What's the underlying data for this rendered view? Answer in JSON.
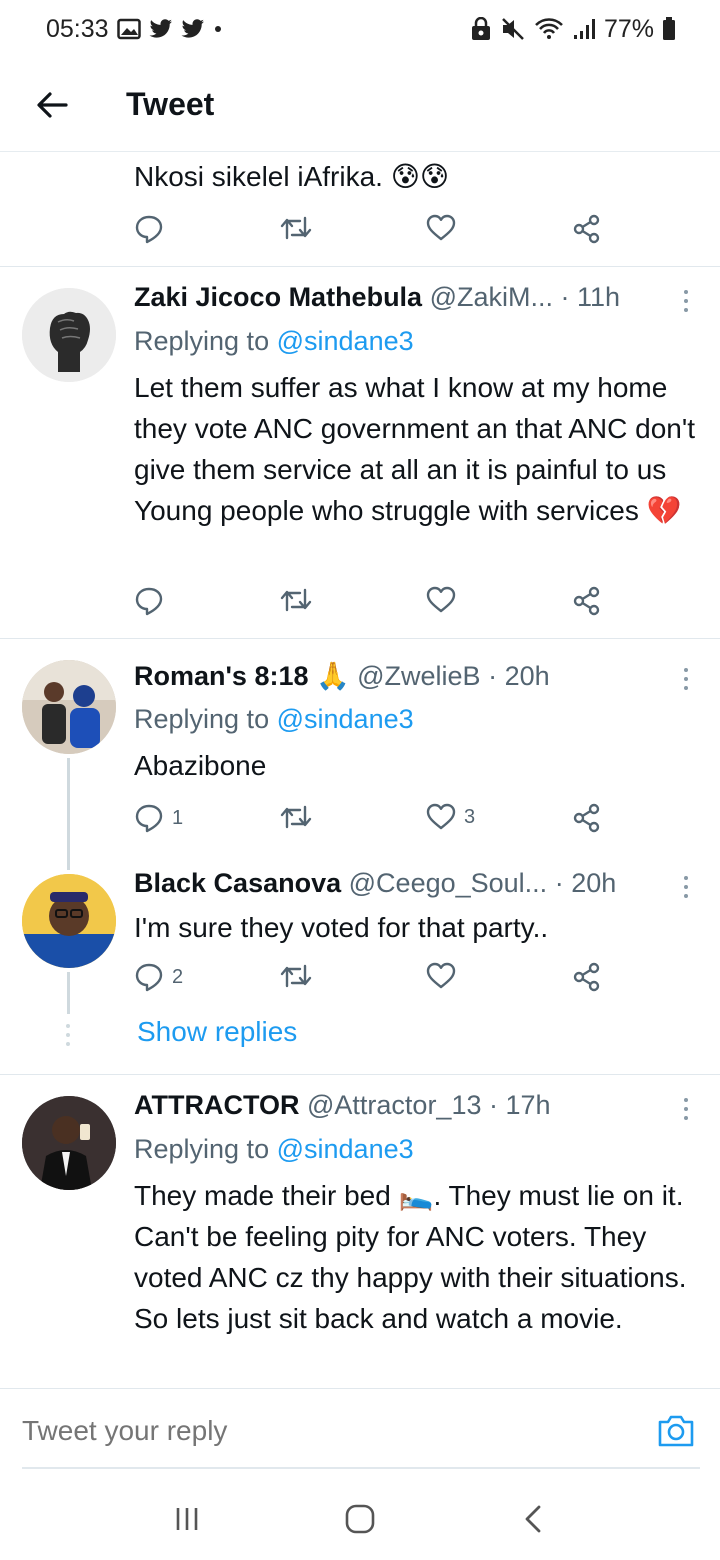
{
  "status_bar": {
    "time": "05:33",
    "battery": "77%"
  },
  "header": {
    "title": "Tweet"
  },
  "previous_tweet": {
    "text": "Nkosi sikelel iAfrika. 😰😰"
  },
  "tweets": [
    {
      "name": "Zaki Jicoco Mathebula",
      "handle": "@ZakiM...",
      "time": "· 11h",
      "replying_prefix": "Replying to",
      "replying_handle": "@sindane3",
      "body": "Let them suffer as what I know at my home they vote ANC government an that ANC don't give them service at all an it is painful to us Young people who struggle with services 💔",
      "reply_count": "",
      "like_count": ""
    },
    {
      "name": "Roman's 8:18 🙏",
      "handle": "@ZwelieB",
      "time": "· 20h",
      "replying_prefix": "Replying to",
      "replying_handle": "@sindane3",
      "body": "Abazibone",
      "reply_count": "1",
      "like_count": "3"
    },
    {
      "name": "Black Casanova",
      "handle": "@Ceego_Soul...",
      "time": "· 20h",
      "body": "I'm sure they voted for that party..",
      "reply_count": "2",
      "like_count": ""
    },
    {
      "name": "ATTRACTOR",
      "handle": "@Attractor_13",
      "time": "· 17h",
      "replying_prefix": "Replying to",
      "replying_handle": "@sindane3",
      "body": "They made their bed 🛌. They must lie on it. Can't be feeling pity for ANC voters. They voted ANC cz thy happy with their situations. So lets just sit back and watch a movie."
    }
  ],
  "show_replies": "Show replies",
  "compose": {
    "placeholder": "Tweet your reply"
  },
  "colors": {
    "accent": "#1d9bf0",
    "secondary_text": "#536471",
    "divider": "#e1e8ed"
  },
  "icons": {
    "reply": "reply-icon",
    "retweet": "retweet-icon",
    "like": "heart-icon",
    "share": "share-icon",
    "back": "back-arrow-icon",
    "camera": "camera-icon"
  }
}
